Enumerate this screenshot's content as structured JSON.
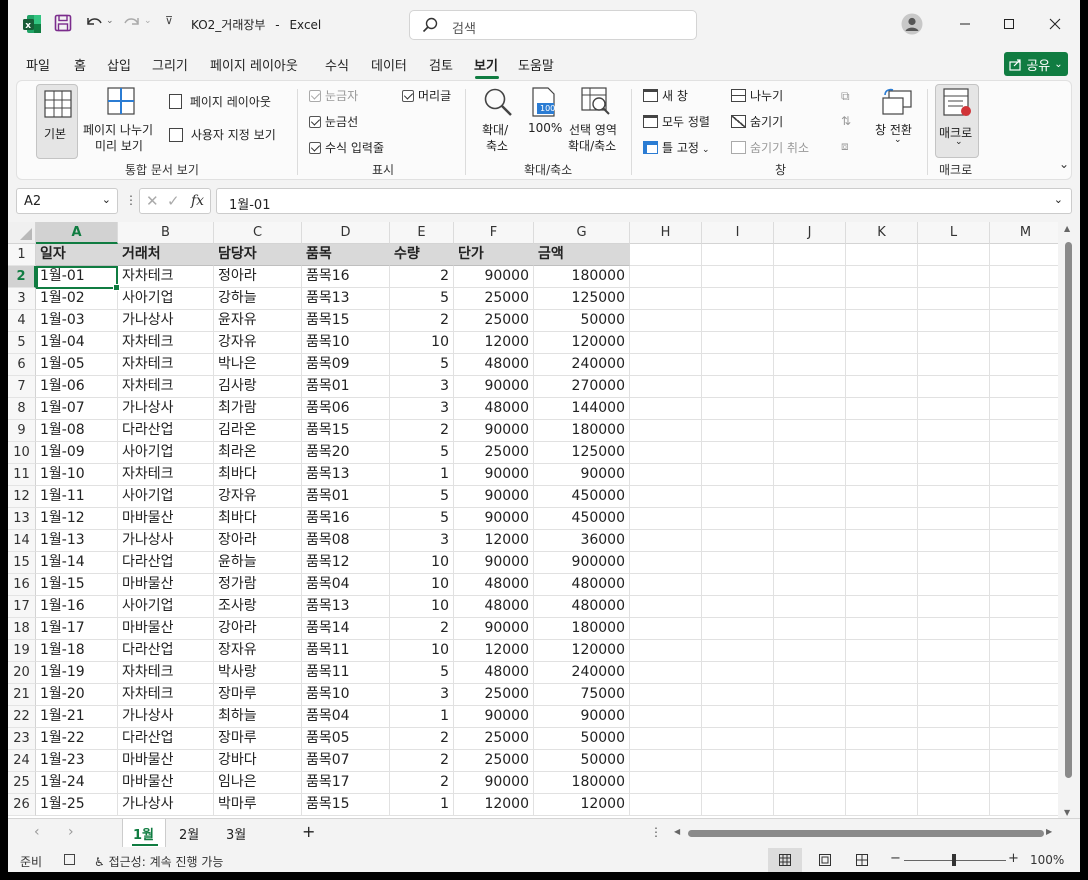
{
  "title_bar": {
    "filename": "KO2_거래장부",
    "separator": "-",
    "app": "Excel",
    "search_placeholder": "검색"
  },
  "menu_tabs": [
    "파일",
    "홈",
    "삽입",
    "그리기",
    "페이지 레이아웃",
    "수식",
    "데이터",
    "검토",
    "보기",
    "도움말"
  ],
  "active_tab": "보기",
  "share_label": "공유",
  "ribbon": {
    "workbook_views": {
      "normal": "기본",
      "page_break_1": "페이지 나누기",
      "page_break_2": "미리 보기",
      "page_layout": "페이지 레이아웃",
      "custom_views": "사용자 지정 보기",
      "label": "통합 문서 보기"
    },
    "show": {
      "ruler": "눈금자",
      "gridlines": "눈금선",
      "formula_bar": "수식 입력줄",
      "headings": "머리글",
      "label": "표시"
    },
    "zoom": {
      "zoom_1": "확대/",
      "zoom_2": "축소",
      "hundred": "100%",
      "hundred_icon": "100",
      "selection_1": "선택 영역",
      "selection_2": "확대/축소",
      "label": "확대/축소"
    },
    "window": {
      "new_window": "새 창",
      "arrange_all": "모두 정렬",
      "freeze_panes": "틀 고정",
      "split": "나누기",
      "hide": "숨기기",
      "unhide": "숨기기 취소",
      "switch_windows": "창 전환",
      "label": "창"
    },
    "macros": {
      "button": "매크로",
      "label": "매크로"
    }
  },
  "formula_bar": {
    "name_box": "A2",
    "fx": "fx",
    "value": "1월-01"
  },
  "columns": [
    "A",
    "B",
    "C",
    "D",
    "E",
    "F",
    "G",
    "H",
    "I",
    "J",
    "K",
    "L",
    "M"
  ],
  "header_row": [
    "일자",
    "거래처",
    "담당자",
    "품목",
    "수량",
    "단가",
    "금액"
  ],
  "rows": [
    [
      "1월-01",
      "자차테크",
      "정아라",
      "품목16",
      "2",
      "90000",
      "180000"
    ],
    [
      "1월-02",
      "사아기업",
      "강하늘",
      "품목13",
      "5",
      "25000",
      "125000"
    ],
    [
      "1월-03",
      "가나상사",
      "윤자유",
      "품목15",
      "2",
      "25000",
      "50000"
    ],
    [
      "1월-04",
      "자차테크",
      "강자유",
      "품목10",
      "10",
      "12000",
      "120000"
    ],
    [
      "1월-05",
      "자차테크",
      "박나은",
      "품목09",
      "5",
      "48000",
      "240000"
    ],
    [
      "1월-06",
      "자차테크",
      "김사랑",
      "품목01",
      "3",
      "90000",
      "270000"
    ],
    [
      "1월-07",
      "가나상사",
      "최가람",
      "품목06",
      "3",
      "48000",
      "144000"
    ],
    [
      "1월-08",
      "다라산업",
      "김라온",
      "품목15",
      "2",
      "90000",
      "180000"
    ],
    [
      "1월-09",
      "사아기업",
      "최라온",
      "품목20",
      "5",
      "25000",
      "125000"
    ],
    [
      "1월-10",
      "자차테크",
      "최바다",
      "품목13",
      "1",
      "90000",
      "90000"
    ],
    [
      "1월-11",
      "사아기업",
      "강자유",
      "품목01",
      "5",
      "90000",
      "450000"
    ],
    [
      "1월-12",
      "마바물산",
      "최바다",
      "품목16",
      "5",
      "90000",
      "450000"
    ],
    [
      "1월-13",
      "가나상사",
      "장아라",
      "품목08",
      "3",
      "12000",
      "36000"
    ],
    [
      "1월-14",
      "다라산업",
      "윤하늘",
      "품목12",
      "10",
      "90000",
      "900000"
    ],
    [
      "1월-15",
      "마바물산",
      "정가람",
      "품목04",
      "10",
      "48000",
      "480000"
    ],
    [
      "1월-16",
      "사아기업",
      "조사랑",
      "품목13",
      "10",
      "48000",
      "480000"
    ],
    [
      "1월-17",
      "마바물산",
      "강아라",
      "품목14",
      "2",
      "90000",
      "180000"
    ],
    [
      "1월-18",
      "다라산업",
      "장자유",
      "품목11",
      "10",
      "12000",
      "120000"
    ],
    [
      "1월-19",
      "자차테크",
      "박사랑",
      "품목11",
      "5",
      "48000",
      "240000"
    ],
    [
      "1월-20",
      "자차테크",
      "장마루",
      "품목10",
      "3",
      "25000",
      "75000"
    ],
    [
      "1월-21",
      "가나상사",
      "최하늘",
      "품목04",
      "1",
      "90000",
      "90000"
    ],
    [
      "1월-22",
      "다라산업",
      "장마루",
      "품목05",
      "2",
      "25000",
      "50000"
    ],
    [
      "1월-23",
      "마바물산",
      "강바다",
      "품목07",
      "2",
      "25000",
      "50000"
    ],
    [
      "1월-24",
      "마바물산",
      "임나은",
      "품목17",
      "2",
      "90000",
      "180000"
    ],
    [
      "1월-25",
      "가나상사",
      "박마루",
      "품목15",
      "1",
      "12000",
      "12000"
    ]
  ],
  "sheets": [
    "1월",
    "2월",
    "3월"
  ],
  "active_sheet": "1월",
  "add_sheet": "+",
  "status": {
    "ready": "준비",
    "accessibility": "접근성: 계속 진행 가능",
    "zoom_minus": "−",
    "zoom_plus": "+",
    "zoom": "100%"
  },
  "colors": {
    "accent": "#107c41",
    "header_fill": "#d9d9d9"
  }
}
